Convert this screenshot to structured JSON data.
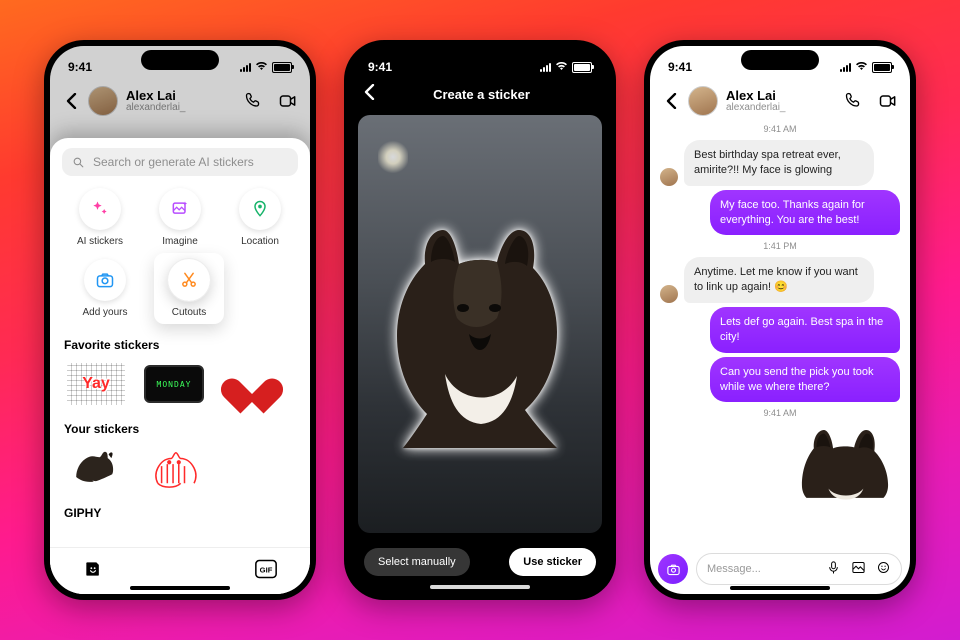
{
  "status": {
    "time": "9:41"
  },
  "phone1": {
    "header": {
      "name": "Alex Lai",
      "handle": "alexanderlai_"
    },
    "search_placeholder": "Search or generate AI stickers",
    "tools": [
      {
        "label": "AI stickers"
      },
      {
        "label": "Imagine"
      },
      {
        "label": "Location"
      },
      {
        "label": "Add yours"
      },
      {
        "label": "Cutouts"
      }
    ],
    "sections": {
      "fav": "Favorite stickers",
      "your": "Your stickers",
      "giphy": "GIPHY"
    },
    "fav": [
      {
        "name": "yay"
      },
      {
        "name": "MONDAY",
        "text": "MONDAY"
      },
      {
        "name": "heart"
      }
    ],
    "your": [
      {
        "name": "dog"
      },
      {
        "name": "red-cat"
      }
    ]
  },
  "phone2": {
    "title": "Create a sticker",
    "btn_manual": "Select manually",
    "btn_use": "Use sticker"
  },
  "phone3": {
    "header": {
      "name": "Alex Lai",
      "handle": "alexanderlai_"
    },
    "ts1": "9:41 AM",
    "ts2": "1:41 PM",
    "ts3": "9:41 AM",
    "msgs": [
      {
        "side": "l",
        "text": "Best birthday spa retreat ever, amirite?!! My face is glowing"
      },
      {
        "side": "r",
        "text": "My face too. Thanks again for everything. You are the best!"
      },
      {
        "side": "l",
        "text": "Anytime. Let me know if you want to link up again! 😊"
      },
      {
        "side": "r",
        "text": "Lets def go again. Best spa in the city!"
      },
      {
        "side": "r",
        "text": "Can you send the pick you took while we where there?"
      }
    ],
    "composer_placeholder": "Message..."
  }
}
